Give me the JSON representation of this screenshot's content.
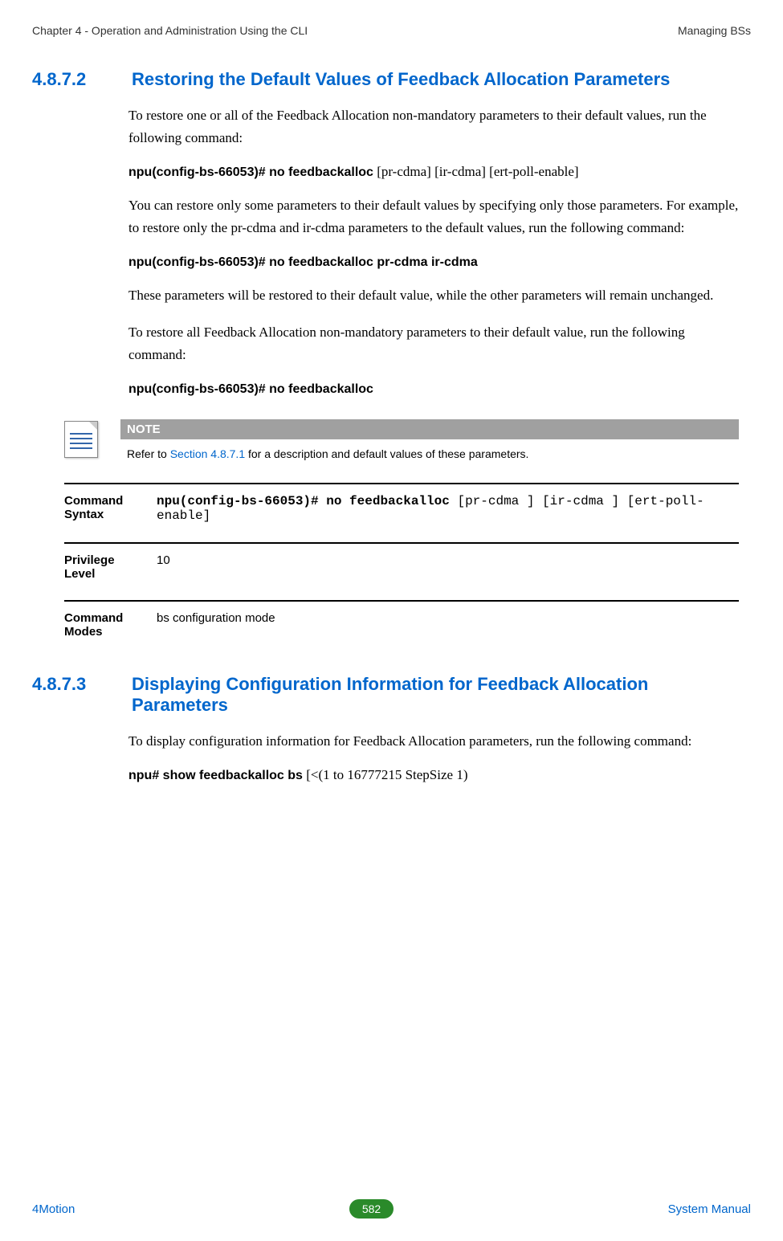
{
  "header": {
    "left": "Chapter 4 - Operation and Administration Using the CLI",
    "right": "Managing BSs"
  },
  "sections": [
    {
      "num": "4.8.7.2",
      "title": "Restoring the Default Values of Feedback Allocation Parameters",
      "paras": {
        "p1": "To restore one or all of the Feedback Allocation non-mandatory parameters to their default values, run the following command:",
        "c1b": "npu(config-bs-66053)# no feedbackalloc",
        "c1r": " [pr-cdma] [ir-cdma] [ert-poll-enable]",
        "p2": "You can restore only some parameters to their default values by specifying only those parameters. For example, to restore only the pr-cdma and ir-cdma parameters to the default values, run the following command:",
        "c2": "npu(config-bs-66053)# no feedbackalloc pr-cdma ir-cdma",
        "p3": "These parameters will be restored to their default value, while the other parameters will remain unchanged.",
        "p4": "To restore all Feedback Allocation non-mandatory parameters to their default value, run the following command:",
        "c3": "npu(config-bs-66053)# no feedbackalloc"
      },
      "note": {
        "title": "NOTE",
        "pre": "Refer to ",
        "link": "Section 4.8.7.1",
        "post": " for a description and default values of these parameters."
      },
      "specs": {
        "syntax_label": "Command Syntax",
        "syntax_b": "npu(config-bs-66053)# no feedbackalloc",
        "syntax_r": " [pr-cdma ] [ir-cdma ] [ert-poll-enable]",
        "priv_label": "Privilege Level",
        "priv_value": "10",
        "modes_label": "Command Modes",
        "modes_value": "bs configuration mode"
      }
    },
    {
      "num": "4.8.7.3",
      "title": "Displaying Configuration Information for Feedback Allocation Parameters",
      "paras": {
        "p1": "To display configuration information for Feedback Allocation parameters, run the following command:",
        "c1b": "npu# show feedbackalloc bs",
        "c1r": " [<(1 to 16777215 StepSize 1)"
      }
    }
  ],
  "footer": {
    "left": "4Motion",
    "center": "582",
    "right": "System Manual"
  }
}
